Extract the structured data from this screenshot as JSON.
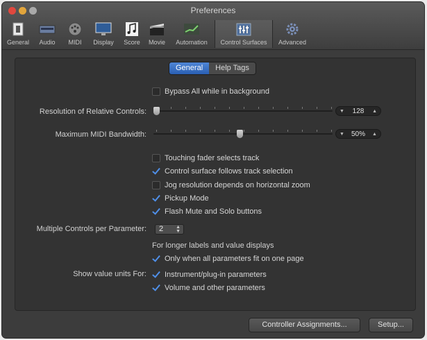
{
  "window": {
    "title": "Preferences"
  },
  "toolbar": {
    "items": [
      {
        "label": "General",
        "icon": "general-icon"
      },
      {
        "label": "Audio",
        "icon": "audio-icon"
      },
      {
        "label": "MIDI",
        "icon": "midi-icon"
      },
      {
        "label": "Display",
        "icon": "display-icon"
      },
      {
        "label": "Score",
        "icon": "score-icon"
      },
      {
        "label": "Movie",
        "icon": "movie-icon"
      },
      {
        "label": "Automation",
        "icon": "automation-icon"
      },
      {
        "label": "Control Surfaces",
        "icon": "control-surfaces-icon",
        "selected": true
      },
      {
        "label": "Advanced",
        "icon": "advanced-icon"
      }
    ]
  },
  "tabs": {
    "general": "General",
    "help_tags": "Help Tags",
    "selected": "General"
  },
  "settings": {
    "bypass_all": {
      "label": "Bypass All while in background",
      "checked": false
    },
    "resolution": {
      "label": "Resolution of Relative Controls:",
      "value": "128"
    },
    "bandwidth": {
      "label": "Maximum MIDI Bandwidth:",
      "value": "50%"
    },
    "touching_fader": {
      "label": "Touching fader selects track",
      "checked": false
    },
    "follows_selection": {
      "label": "Control surface follows track selection",
      "checked": true
    },
    "jog_resolution": {
      "label": "Jog resolution depends on horizontal zoom",
      "checked": false
    },
    "pickup_mode": {
      "label": "Pickup Mode",
      "checked": true
    },
    "flash_mute": {
      "label": "Flash Mute and Solo buttons",
      "checked": true
    },
    "multiple_controls": {
      "label": "Multiple Controls per Parameter:",
      "value": "2"
    },
    "longer_labels_note": "For longer labels and value displays",
    "only_when_fit": {
      "label": "Only when all parameters fit on one page",
      "checked": true
    },
    "show_units_label": "Show value units For:",
    "units_instrument": {
      "label": "Instrument/plug-in parameters",
      "checked": true
    },
    "units_volume": {
      "label": "Volume and other parameters",
      "checked": true
    }
  },
  "buttons": {
    "controller_assignments": "Controller Assignments...",
    "setup": "Setup..."
  },
  "colors": {
    "accent": "#2a5fb2",
    "checkmark": "#4f8fe8"
  }
}
